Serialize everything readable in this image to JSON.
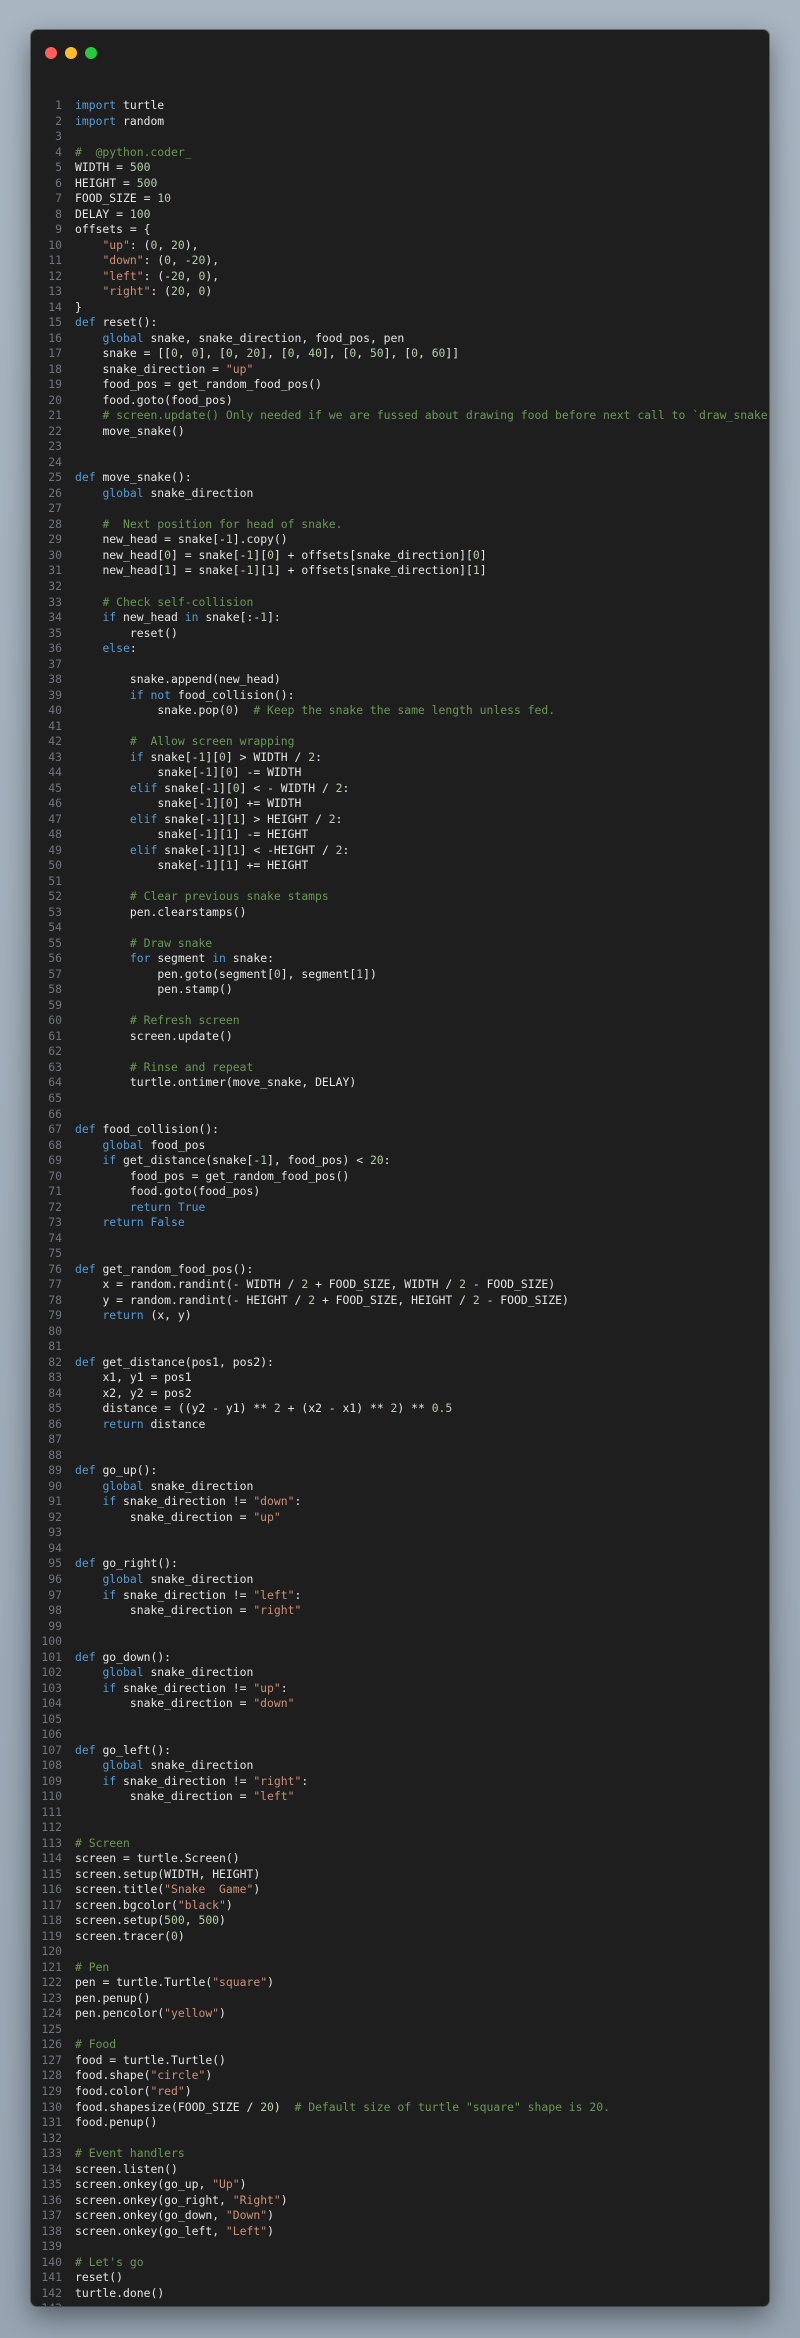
{
  "window": {
    "controls": [
      "close",
      "minimize",
      "maximize"
    ],
    "colors": {
      "background": "#1e1e1e",
      "line_number": "#6e7681",
      "keyword": "#569cd6",
      "string": "#ce9178",
      "number": "#b5cea8",
      "comment": "#6a9955",
      "text": "#e6e6e6"
    }
  },
  "code": {
    "lines": [
      {
        "n": "1",
        "t": "import turtle"
      },
      {
        "n": "2",
        "t": "import random"
      },
      {
        "n": "3",
        "t": ""
      },
      {
        "n": "4",
        "t": "#  @python.coder_"
      },
      {
        "n": "5",
        "t": "WIDTH = 500"
      },
      {
        "n": "6",
        "t": "HEIGHT = 500"
      },
      {
        "n": "7",
        "t": "FOOD_SIZE = 10"
      },
      {
        "n": "8",
        "t": "DELAY = 100"
      },
      {
        "n": "9",
        "t": "offsets = {"
      },
      {
        "n": "10",
        "t": "    \"up\": (0, 20),"
      },
      {
        "n": "11",
        "t": "    \"down\": (0, -20),"
      },
      {
        "n": "12",
        "t": "    \"left\": (-20, 0),"
      },
      {
        "n": "13",
        "t": "    \"right\": (20, 0)"
      },
      {
        "n": "14",
        "t": "}"
      },
      {
        "n": "15",
        "t": "def reset():"
      },
      {
        "n": "16",
        "t": "    global snake, snake_direction, food_pos, pen"
      },
      {
        "n": "17",
        "t": "    snake = [[0, 0], [0, 20], [0, 40], [0, 50], [0, 60]]"
      },
      {
        "n": "18",
        "t": "    snake_direction = \"up\""
      },
      {
        "n": "19",
        "t": "    food_pos = get_random_food_pos()"
      },
      {
        "n": "20",
        "t": "    food.goto(food_pos)"
      },
      {
        "n": "21",
        "t": "    # screen.update() Only needed if we are fussed about drawing food before next call to `draw_snake()`."
      },
      {
        "n": "22",
        "t": "    move_snake()"
      },
      {
        "n": "23",
        "t": ""
      },
      {
        "n": "24",
        "t": ""
      },
      {
        "n": "25",
        "t": "def move_snake():"
      },
      {
        "n": "26",
        "t": "    global snake_direction"
      },
      {
        "n": "27",
        "t": ""
      },
      {
        "n": "28",
        "t": "    #  Next position for head of snake."
      },
      {
        "n": "29",
        "t": "    new_head = snake[-1].copy()"
      },
      {
        "n": "30",
        "t": "    new_head[0] = snake[-1][0] + offsets[snake_direction][0]"
      },
      {
        "n": "31",
        "t": "    new_head[1] = snake[-1][1] + offsets[snake_direction][1]"
      },
      {
        "n": "32",
        "t": ""
      },
      {
        "n": "33",
        "t": "    # Check self-collision"
      },
      {
        "n": "34",
        "t": "    if new_head in snake[:-1]:"
      },
      {
        "n": "35",
        "t": "        reset()"
      },
      {
        "n": "36",
        "t": "    else:"
      },
      {
        "n": "37",
        "t": ""
      },
      {
        "n": "38",
        "t": "        snake.append(new_head)"
      },
      {
        "n": "39",
        "t": "        if not food_collision():"
      },
      {
        "n": "40",
        "t": "            snake.pop(0)  # Keep the snake the same length unless fed."
      },
      {
        "n": "41",
        "t": ""
      },
      {
        "n": "42",
        "t": "        #  Allow screen wrapping"
      },
      {
        "n": "43",
        "t": "        if snake[-1][0] > WIDTH / 2:"
      },
      {
        "n": "44",
        "t": "            snake[-1][0] -= WIDTH"
      },
      {
        "n": "45",
        "t": "        elif snake[-1][0] < - WIDTH / 2:"
      },
      {
        "n": "46",
        "t": "            snake[-1][0] += WIDTH"
      },
      {
        "n": "47",
        "t": "        elif snake[-1][1] > HEIGHT / 2:"
      },
      {
        "n": "48",
        "t": "            snake[-1][1] -= HEIGHT"
      },
      {
        "n": "49",
        "t": "        elif snake[-1][1] < -HEIGHT / 2:"
      },
      {
        "n": "50",
        "t": "            snake[-1][1] += HEIGHT"
      },
      {
        "n": "51",
        "t": ""
      },
      {
        "n": "52",
        "t": "        # Clear previous snake stamps"
      },
      {
        "n": "53",
        "t": "        pen.clearstamps()"
      },
      {
        "n": "54",
        "t": ""
      },
      {
        "n": "55",
        "t": "        # Draw snake"
      },
      {
        "n": "56",
        "t": "        for segment in snake:"
      },
      {
        "n": "57",
        "t": "            pen.goto(segment[0], segment[1])"
      },
      {
        "n": "58",
        "t": "            pen.stamp()"
      },
      {
        "n": "59",
        "t": ""
      },
      {
        "n": "60",
        "t": "        # Refresh screen"
      },
      {
        "n": "61",
        "t": "        screen.update()"
      },
      {
        "n": "62",
        "t": ""
      },
      {
        "n": "63",
        "t": "        # Rinse and repeat"
      },
      {
        "n": "64",
        "t": "        turtle.ontimer(move_snake, DELAY)"
      },
      {
        "n": "65",
        "t": ""
      },
      {
        "n": "66",
        "t": ""
      },
      {
        "n": "67",
        "t": "def food_collision():"
      },
      {
        "n": "68",
        "t": "    global food_pos"
      },
      {
        "n": "69",
        "t": "    if get_distance(snake[-1], food_pos) < 20:"
      },
      {
        "n": "70",
        "t": "        food_pos = get_random_food_pos()"
      },
      {
        "n": "71",
        "t": "        food.goto(food_pos)"
      },
      {
        "n": "72",
        "t": "        return True"
      },
      {
        "n": "73",
        "t": "    return False"
      },
      {
        "n": "74",
        "t": ""
      },
      {
        "n": "75",
        "t": ""
      },
      {
        "n": "76",
        "t": "def get_random_food_pos():"
      },
      {
        "n": "77",
        "t": "    x = random.randint(- WIDTH / 2 + FOOD_SIZE, WIDTH / 2 - FOOD_SIZE)"
      },
      {
        "n": "78",
        "t": "    y = random.randint(- HEIGHT / 2 + FOOD_SIZE, HEIGHT / 2 - FOOD_SIZE)"
      },
      {
        "n": "79",
        "t": "    return (x, y)"
      },
      {
        "n": "80",
        "t": ""
      },
      {
        "n": "81",
        "t": ""
      },
      {
        "n": "82",
        "t": "def get_distance(pos1, pos2):"
      },
      {
        "n": "83",
        "t": "    x1, y1 = pos1"
      },
      {
        "n": "84",
        "t": "    x2, y2 = pos2"
      },
      {
        "n": "85",
        "t": "    distance = ((y2 - y1) ** 2 + (x2 - x1) ** 2) ** 0.5"
      },
      {
        "n": "86",
        "t": "    return distance"
      },
      {
        "n": "87",
        "t": ""
      },
      {
        "n": "88",
        "t": ""
      },
      {
        "n": "89",
        "t": "def go_up():"
      },
      {
        "n": "90",
        "t": "    global snake_direction"
      },
      {
        "n": "91",
        "t": "    if snake_direction != \"down\":"
      },
      {
        "n": "92",
        "t": "        snake_direction = \"up\""
      },
      {
        "n": "93",
        "t": ""
      },
      {
        "n": "94",
        "t": ""
      },
      {
        "n": "95",
        "t": "def go_right():"
      },
      {
        "n": "96",
        "t": "    global snake_direction"
      },
      {
        "n": "97",
        "t": "    if snake_direction != \"left\":"
      },
      {
        "n": "98",
        "t": "        snake_direction = \"right\""
      },
      {
        "n": "99",
        "t": ""
      },
      {
        "n": "100",
        "t": ""
      },
      {
        "n": "101",
        "t": "def go_down():"
      },
      {
        "n": "102",
        "t": "    global snake_direction"
      },
      {
        "n": "103",
        "t": "    if snake_direction != \"up\":"
      },
      {
        "n": "104",
        "t": "        snake_direction = \"down\""
      },
      {
        "n": "105",
        "t": ""
      },
      {
        "n": "106",
        "t": ""
      },
      {
        "n": "107",
        "t": "def go_left():"
      },
      {
        "n": "108",
        "t": "    global snake_direction"
      },
      {
        "n": "109",
        "t": "    if snake_direction != \"right\":"
      },
      {
        "n": "110",
        "t": "        snake_direction = \"left\""
      },
      {
        "n": "111",
        "t": ""
      },
      {
        "n": "112",
        "t": ""
      },
      {
        "n": "113",
        "t": "# Screen"
      },
      {
        "n": "114",
        "t": "screen = turtle.Screen()"
      },
      {
        "n": "115",
        "t": "screen.setup(WIDTH, HEIGHT)"
      },
      {
        "n": "116",
        "t": "screen.title(\"Snake  Game\")"
      },
      {
        "n": "117",
        "t": "screen.bgcolor(\"black\")"
      },
      {
        "n": "118",
        "t": "screen.setup(500, 500)"
      },
      {
        "n": "119",
        "t": "screen.tracer(0)"
      },
      {
        "n": "120",
        "t": ""
      },
      {
        "n": "121",
        "t": "# Pen"
      },
      {
        "n": "122",
        "t": "pen = turtle.Turtle(\"square\")"
      },
      {
        "n": "123",
        "t": "pen.penup()"
      },
      {
        "n": "124",
        "t": "pen.pencolor(\"yellow\")"
      },
      {
        "n": "125",
        "t": ""
      },
      {
        "n": "126",
        "t": "# Food"
      },
      {
        "n": "127",
        "t": "food = turtle.Turtle()"
      },
      {
        "n": "128",
        "t": "food.shape(\"circle\")"
      },
      {
        "n": "129",
        "t": "food.color(\"red\")"
      },
      {
        "n": "130",
        "t": "food.shapesize(FOOD_SIZE / 20)  # Default size of turtle \"square\" shape is 20."
      },
      {
        "n": "131",
        "t": "food.penup()"
      },
      {
        "n": "132",
        "t": ""
      },
      {
        "n": "133",
        "t": "# Event handlers"
      },
      {
        "n": "134",
        "t": "screen.listen()"
      },
      {
        "n": "135",
        "t": "screen.onkey(go_up, \"Up\")"
      },
      {
        "n": "136",
        "t": "screen.onkey(go_right, \"Right\")"
      },
      {
        "n": "137",
        "t": "screen.onkey(go_down, \"Down\")"
      },
      {
        "n": "138",
        "t": "screen.onkey(go_left, \"Left\")"
      },
      {
        "n": "139",
        "t": ""
      },
      {
        "n": "140",
        "t": "# Let's go"
      },
      {
        "n": "141",
        "t": "reset()"
      },
      {
        "n": "142",
        "t": "turtle.done()"
      },
      {
        "n": "143",
        "t": ""
      }
    ]
  }
}
